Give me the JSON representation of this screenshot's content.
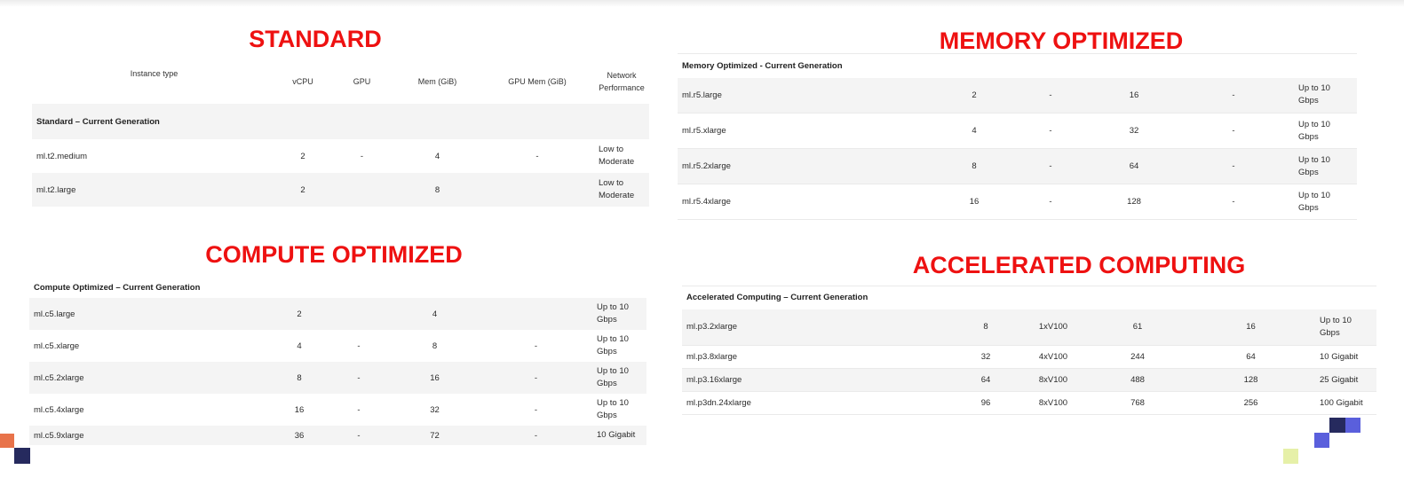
{
  "standard": {
    "heading": "STANDARD",
    "columns": [
      "Instance type",
      "vCPU",
      "GPU",
      "Mem (GiB)",
      "GPU Mem (GiB)",
      "Network Performance"
    ],
    "group": "Standard – Current Generation",
    "rows": [
      [
        "ml.t2.medium",
        "2",
        "-",
        "4",
        "-",
        "Low to Moderate"
      ],
      [
        "ml.t2.large",
        "2",
        "",
        "8",
        "",
        "Low to Moderate"
      ]
    ]
  },
  "compute": {
    "heading": "COMPUTE OPTIMIZED",
    "group": "Compute Optimized – Current Generation",
    "rows": [
      [
        "ml.c5.large",
        "2",
        "",
        "4",
        "",
        "Up to 10 Gbps"
      ],
      [
        "ml.c5.xlarge",
        "4",
        "-",
        "8",
        "-",
        "Up to 10 Gbps"
      ],
      [
        "ml.c5.2xlarge",
        "8",
        "-",
        "16",
        "-",
        "Up to 10 Gbps"
      ],
      [
        "ml.c5.4xlarge",
        "16",
        "-",
        "32",
        "-",
        "Up to 10 Gbps"
      ],
      [
        "ml.c5.9xlarge",
        "36",
        "-",
        "72",
        "-",
        "10 Gigabit"
      ]
    ]
  },
  "memory": {
    "heading": "MEMORY OPTIMIZED",
    "group": "Memory Optimized - Current Generation",
    "rows": [
      [
        "ml.r5.large",
        "2",
        "-",
        "16",
        "-",
        "Up to 10 Gbps"
      ],
      [
        "ml.r5.xlarge",
        "4",
        "-",
        "32",
        "-",
        "Up to 10 Gbps"
      ],
      [
        "ml.r5.2xlarge",
        "8",
        "-",
        "64",
        "-",
        "Up to 10 Gbps"
      ],
      [
        "ml.r5.4xlarge",
        "16",
        "-",
        "128",
        "-",
        "Up to 10 Gbps"
      ]
    ]
  },
  "accelerated": {
    "heading": "ACCELERATED COMPUTING",
    "group": "Accelerated Computing – Current Generation",
    "rows": [
      [
        "ml.p3.2xlarge",
        "8",
        "1xV100",
        "61",
        "16",
        "Up to 10 Gbps"
      ],
      [
        "ml.p3.8xlarge",
        "32",
        "4xV100",
        "244",
        "64",
        "10 Gigabit"
      ],
      [
        "ml.p3.16xlarge",
        "64",
        "8xV100",
        "488",
        "128",
        "25 Gigabit"
      ],
      [
        "ml.p3dn.24xlarge",
        "96",
        "8xV100",
        "768",
        "256",
        "100 Gigabit"
      ]
    ]
  },
  "decor_colors": {
    "orange": "#e8734a",
    "navy": "#262a5e",
    "blue": "#5a5fdc",
    "lime": "#e6f0a8"
  }
}
